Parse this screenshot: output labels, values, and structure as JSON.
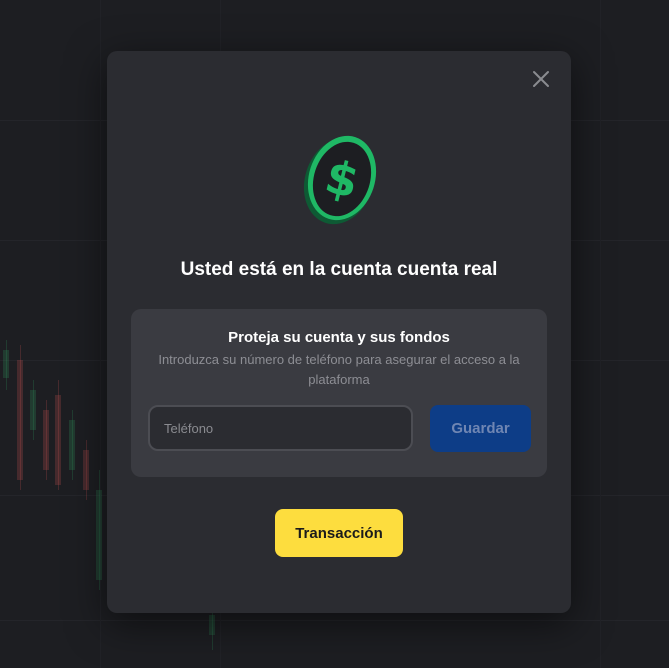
{
  "modal": {
    "title": "Usted está en la cuenta cuenta real",
    "close_icon": "close-icon",
    "coin_icon": "dollar-coin-icon",
    "panel": {
      "title": "Proteja su cuenta y sus fondos",
      "description": "Introduzca su número de teléfono para asegurar el acceso a la plataforma",
      "phone_placeholder": "Teléfono",
      "phone_value": "",
      "save_label": "Guardar"
    },
    "transaction_label": "Transacción"
  },
  "colors": {
    "modal_bg": "#2b2c31",
    "panel_bg": "#3a3b41",
    "save_button": "#0d3d87",
    "transaction_button": "#fddd3e",
    "coin_green": "#1fb865"
  }
}
